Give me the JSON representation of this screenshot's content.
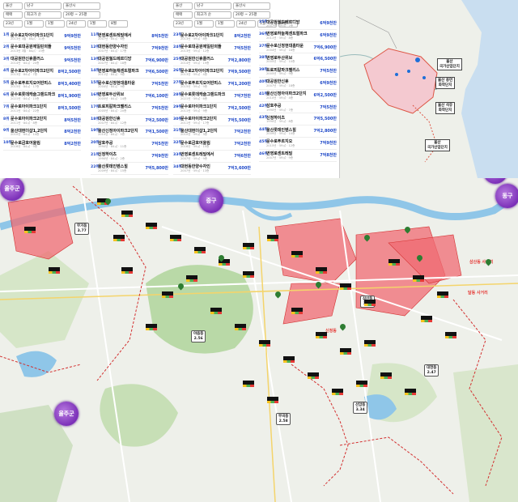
{
  "filters_left": {
    "row1": [
      "울산",
      "남구",
      "울산시"
    ],
    "row2": [
      "매매",
      "최고가 순",
      "20평 ~ 25평"
    ],
    "row3": [
      "23년",
      "1월",
      "1월",
      "24년",
      "1월",
      "8월"
    ]
  },
  "filters_right": {
    "row1": [
      "울산",
      "남구",
      "울산시"
    ],
    "row2": [
      "매매",
      "최고가 순",
      "20평 ~ 25평"
    ],
    "row3": [
      "23년",
      "1월",
      "1월",
      "24년",
      "1월",
      "8월"
    ]
  },
  "listing_col1": [
    {
      "rank": "1위",
      "name": "문수로2차아이파크1단지",
      "sub": "2013년 3월 · 84㎡ · 11층",
      "price": "9억9천만"
    },
    {
      "rank": "2위",
      "name": "문수로대공원에일린의뜰",
      "sub": "2013년 3월 · 84㎡ · 15층",
      "price": "9억5천만"
    },
    {
      "rank": "3위",
      "name": "대공원한신휴플러스",
      "sub": "2014년 · 84㎡ · 20층",
      "price": "9억5천만"
    },
    {
      "rank": "4위",
      "name": "문수로2차아이파크2단지",
      "sub": "2013년 · 84㎡ · 7층",
      "price": "8억2,500만"
    },
    {
      "rank": "5위",
      "name": "문수로푸르지오어반피스",
      "sub": "2015년 · 84㎡ · 17층",
      "price": "8억3,400만"
    },
    {
      "rank": "6위",
      "name": "문수로롯데캐슬그랜드파크",
      "sub": "2021년 · 84㎡ · 15층",
      "price": "8억1,900만"
    },
    {
      "rank": "7위",
      "name": "문수로아이파크1단지",
      "sub": "2011년 · 84㎡ · 22층",
      "price": "8억3,500만"
    },
    {
      "rank": "8위",
      "name": "문수로아이파크2단지",
      "sub": "2011년 · 84㎡ · 8층",
      "price": "8억5천만"
    },
    {
      "rank": "9위",
      "name": "울산대현더샵1,2단지",
      "sub": "2010년 · 84㎡ · 14층",
      "price": "8억2천만"
    },
    {
      "rank": "10위",
      "name": "문수로금호어울림",
      "sub": "2016년 · 84㎡ · 9층",
      "price": "8억2천만"
    }
  ],
  "listing_col2": [
    {
      "rank": "11위",
      "name": "번영로센트레빌에서",
      "sub": "2007년 · 84㎡ · 6층",
      "price": "8억5천만"
    },
    {
      "rank": "12위",
      "name": "대현동한양수자인",
      "sub": "2007년 · 84㎡ · 17층",
      "price": "7억9천만"
    },
    {
      "rank": "13위",
      "name": "대공원월드메르디앙",
      "sub": "2007년 · 84㎡ · 18층",
      "price": "7억6,900만"
    },
    {
      "rank": "14위",
      "name": "번영로하늘채센트럴파크",
      "sub": "2011년 · 84㎡ · 9층",
      "price": "7억6,500만"
    },
    {
      "rank": "15위",
      "name": "문수로신정현대홈타운",
      "sub": "2004년 · 84㎡ · 9층",
      "price": "7억5천만"
    },
    {
      "rank": "16위",
      "name": "번영로두산위브",
      "sub": "2005년 · 84㎡ · 14층",
      "price": "7억6,100만"
    },
    {
      "rank": "17위",
      "name": "트로피칼파크팰리스",
      "sub": "2005년 · 84㎡ · 20층",
      "price": "7억5천만"
    },
    {
      "rank": "18위",
      "name": "대공원한신휴",
      "sub": "2007년 · 84㎡ · 12층",
      "price": "7억2,500만"
    },
    {
      "rank": "19위",
      "name": "울산신정아이파크2단지",
      "sub": "2010년 · 84㎡ · 5층",
      "price": "7억1,500만"
    },
    {
      "rank": "20위",
      "name": "삼호주공",
      "sub": "1990년 · 84㎡ · 11층",
      "price": "7억5천만"
    },
    {
      "rank": "21위",
      "name": "신정하이츠",
      "sub": "1990년 · 84㎡ · 2층",
      "price": "7억9천만"
    },
    {
      "rank": "22위",
      "name": "울산롯데인벤스힐",
      "sub": "2009년 · 84㎡ · 15층",
      "price": "7억5,800만"
    }
  ],
  "listing_col3": [
    {
      "rank": "23위",
      "name": "문수로2차아이파크1단지",
      "sub": "2013년 · 59㎡ · 8층",
      "price": "8억2천만"
    },
    {
      "rank": "24위",
      "name": "문수로대공원에일린의뜰",
      "sub": "2013년 · 59㎡ · 12층",
      "price": "7억5천만"
    },
    {
      "rank": "25위",
      "name": "대공원한신휴플러스",
      "sub": "2014년 · 59㎡ · 19층",
      "price": "7억2,800만"
    },
    {
      "rank": "26위",
      "name": "문수로2차아이파크2단지",
      "sub": "2013년 · 59㎡ · 4층",
      "price": "7억9,500만"
    },
    {
      "rank": "27위",
      "name": "문수로푸르지오어반피스",
      "sub": "2015년 · 59㎡ · 9층",
      "price": "7억1,200만"
    },
    {
      "rank": "28위",
      "name": "문수로롯데캐슬그랜드파크",
      "sub": "2021년 · 59㎡ · 6층",
      "price": "7억7천만"
    },
    {
      "rank": "29위",
      "name": "문수로아이파크1단지",
      "sub": "2011년 · 59㎡ · 9층",
      "price": "7억2,500만"
    },
    {
      "rank": "30위",
      "name": "문수로아이파크2단지",
      "sub": "2011년 · 59㎡ · 17층",
      "price": "7억5,500만"
    },
    {
      "rank": "31위",
      "name": "울산대현더샵1,2단지",
      "sub": "2010년 · 59㎡ · 3층",
      "price": "7억2천만"
    },
    {
      "rank": "32위",
      "name": "문수로금호어울림",
      "sub": "2016년 · 59㎡ · 15층",
      "price": "7억2천만"
    },
    {
      "rank": "33위",
      "name": "번영로센트레빌에서",
      "sub": "2007년 · 59㎡ · 9층",
      "price": "7억6천만"
    },
    {
      "rank": "34위",
      "name": "대현동한양수자인",
      "sub": "2007년 · 59㎡ · 13층",
      "price": "7억3,600만"
    }
  ],
  "listing_col4": [
    {
      "rank": "35위",
      "name": "대공원월드메르디앙",
      "sub": "2007년 · 59㎡ · 7층",
      "price": "6억9천만"
    },
    {
      "rank": "36위",
      "name": "번영로하늘채센트럴파크",
      "sub": "2011년 · 59㎡ · 8층",
      "price": "6억9천만"
    },
    {
      "rank": "37위",
      "name": "문수로신정현대홈타운",
      "sub": "2004년 · 59㎡ · 18층",
      "price": "7억6,900만"
    },
    {
      "rank": "38위",
      "name": "번영로두산위브",
      "sub": "2005년 · 59㎡ · 10층",
      "price": "6억6,500만"
    },
    {
      "rank": "39위",
      "name": "트로피칼파크팰리스",
      "sub": "2005년 · 59㎡ · 9층",
      "price": "7억5천만"
    },
    {
      "rank": "40위",
      "name": "대공원한신휴",
      "sub": "2007년 · 59㎡ · 18층",
      "price": "6억9천만"
    },
    {
      "rank": "41위",
      "name": "울산신정아이파크2단지",
      "sub": "2010년 · 59㎡ · 4층",
      "price": "6억2,500만"
    },
    {
      "rank": "42위",
      "name": "삼호주공",
      "sub": "1990년 · 59㎡ · 7층",
      "price": "7억5천만"
    },
    {
      "rank": "43위",
      "name": "신정하이츠",
      "sub": "1990년 · 59㎡ · 8층",
      "price": "7억5,500만"
    },
    {
      "rank": "44위",
      "name": "울산롯데인벤스힐",
      "sub": "2009년 · 59㎡ · 10층",
      "price": "7억2,800만"
    },
    {
      "rank": "45위",
      "name": "문수로푸르지오",
      "sub": "2015년 · 59㎡ · 12층",
      "price": "7억9천만"
    },
    {
      "rank": "46위",
      "name": "번영로센트레빌",
      "sub": "2007년 · 59㎡ · 9층",
      "price": "7억8천만"
    }
  ],
  "inset_map": {
    "labels": [
      "울산\n국가산업단지",
      "울산 용연\n화학단지",
      "울산 석유\n화학단지",
      "울산\n국가산업단지"
    ],
    "pins": 4
  },
  "main_map": {
    "districts": [
      "울주군",
      "중구",
      "북구",
      "동구",
      "울주군"
    ],
    "areas": [
      {
        "name": "무거동",
        "value": "3.77"
      },
      {
        "name": "야음동",
        "value": "2.56"
      },
      {
        "name": "삼산동",
        "value": "1.95"
      },
      {
        "name": "대현동",
        "value": "2.47"
      },
      {
        "name": "선암동",
        "value": "3.34"
      },
      {
        "name": "부곡동",
        "value": "2.58"
      }
    ],
    "red_labels": [
      "신정동",
      "삼산동 사거리",
      "달동 사거리"
    ],
    "colors": {
      "zone": "#f06b73",
      "river": "#8fc6e8",
      "park": "#b9d9a7",
      "border": "#d32f2f",
      "district": "#7b2fb8"
    }
  }
}
